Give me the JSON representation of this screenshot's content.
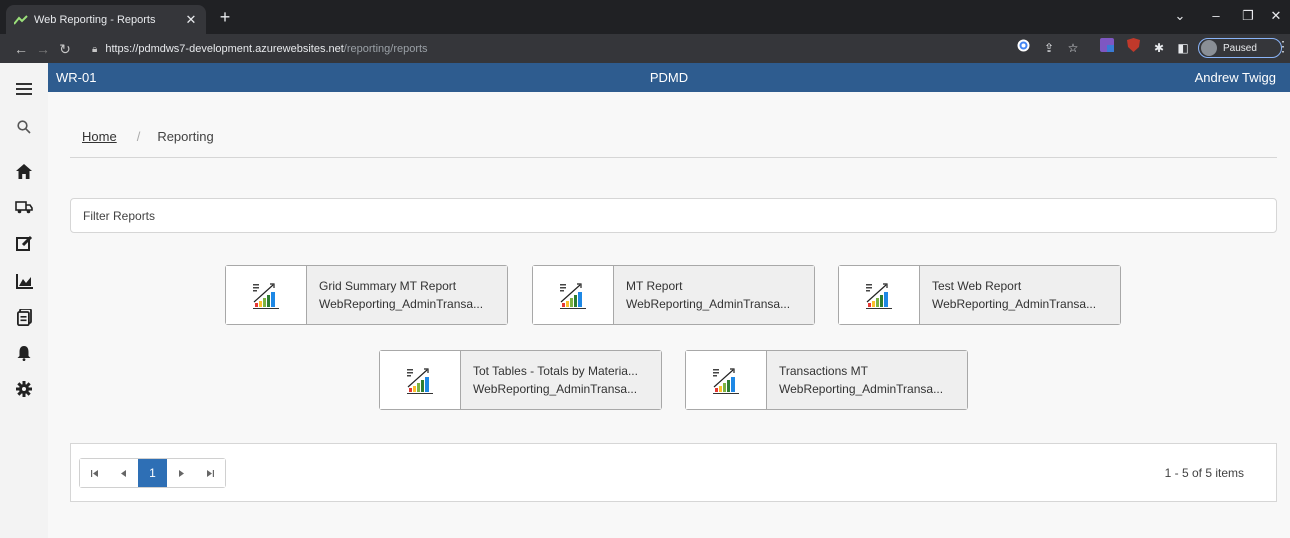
{
  "browser": {
    "tab_title": "Web Reporting - Reports",
    "tab_close": "✕",
    "new_tab": "+",
    "url_host": "https://pdmdws7-development.azurewebsites.net",
    "url_path": "/reporting/reports",
    "profile_status": "Paused"
  },
  "app": {
    "code": "WR-01",
    "title": "PDMD",
    "user": "Andrew Twigg"
  },
  "breadcrumb": {
    "home": "Home",
    "separator": "/",
    "current": "Reporting"
  },
  "filter": {
    "placeholder": "Filter Reports"
  },
  "reports": [
    {
      "name": "Grid Summary MT Report",
      "source": "WebReporting_AdminTransa..."
    },
    {
      "name": "MT Report",
      "source": "WebReporting_AdminTransa..."
    },
    {
      "name": "Test Web Report",
      "source": "WebReporting_AdminTransa..."
    },
    {
      "name": "Tot Tables - Totals by Materia...",
      "source": "WebReporting_AdminTransa..."
    },
    {
      "name": "Transactions MT",
      "source": "WebReporting_AdminTransa..."
    }
  ],
  "pager": {
    "current_page": "1",
    "info": "1 - 5 of 5 items"
  },
  "sidebar_icons": [
    "menu-icon",
    "search-icon",
    "home-icon",
    "truck-icon",
    "edit-icon",
    "chart-icon",
    "documents-icon",
    "bell-icon",
    "gear-icon"
  ],
  "colors": {
    "app_bar": "#2e5c8f",
    "pager_active": "#2e6fb5",
    "browser_dark": "#202124"
  }
}
